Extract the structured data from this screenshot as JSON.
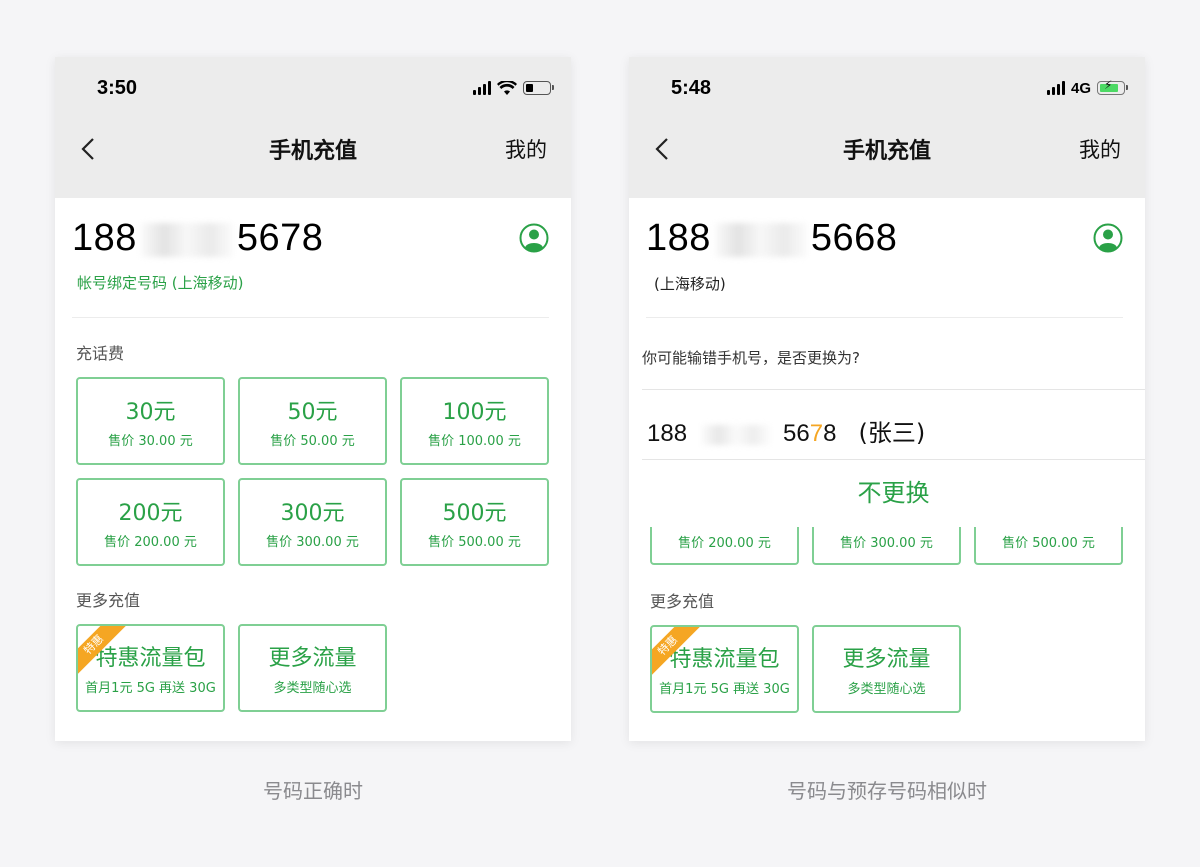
{
  "colors": {
    "accent": "#2aa147",
    "border": "#7fcf94",
    "badge": "#f5a623",
    "highlight": "#f5a623"
  },
  "left": {
    "status": {
      "time": "3:50"
    },
    "nav": {
      "title": "手机充值",
      "mine": "我的"
    },
    "phone": {
      "prefix": "188",
      "suffix": "5678"
    },
    "bind_label": "帐号绑定号码 (上海移动)",
    "section_recharge": "充话费",
    "recharge_cards": [
      {
        "amount": "30元",
        "price": "售价 30.00 元"
      },
      {
        "amount": "50元",
        "price": "售价 50.00 元"
      },
      {
        "amount": "100元",
        "price": "售价 100.00 元"
      },
      {
        "amount": "200元",
        "price": "售价 200.00 元"
      },
      {
        "amount": "300元",
        "price": "售价 300.00 元"
      },
      {
        "amount": "500元",
        "price": "售价 500.00 元"
      }
    ],
    "section_more": "更多充值",
    "more_cards": [
      {
        "title": "特惠流量包",
        "sub": "首月1元 5G 再送 30G",
        "badge": "特惠"
      },
      {
        "title": "更多流量",
        "sub": "多类型随心选"
      }
    ],
    "caption": "号码正确时"
  },
  "right": {
    "status": {
      "time": "5:48",
      "network": "4G"
    },
    "nav": {
      "title": "手机充值",
      "mine": "我的"
    },
    "phone": {
      "prefix": "188",
      "suffix": "5668"
    },
    "carrier_label": "(上海移动)",
    "suggest": {
      "prompt": "你可能输错手机号，是否更换为?",
      "prefix": "188",
      "suffix_a": "56",
      "suffix_highlight": "7",
      "suffix_b": "8",
      "name": "(张三)",
      "no_change": "不更换"
    },
    "cut_cards": [
      {
        "price": "售价 200.00 元"
      },
      {
        "price": "售价 300.00 元"
      },
      {
        "price": "售价 500.00 元"
      }
    ],
    "section_more": "更多充值",
    "more_cards": [
      {
        "title": "特惠流量包",
        "sub": "首月1元 5G 再送 30G",
        "badge": "特惠"
      },
      {
        "title": "更多流量",
        "sub": "多类型随心选"
      }
    ],
    "caption": "号码与预存号码相似时"
  }
}
